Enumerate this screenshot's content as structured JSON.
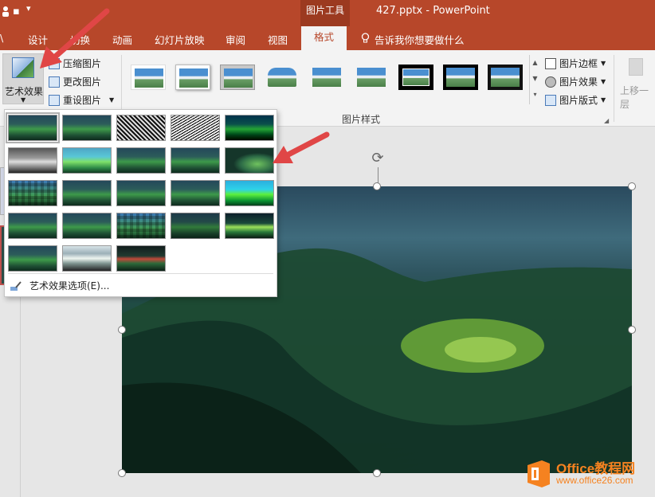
{
  "title_bar": {
    "context_tab": "图片工具",
    "document_title": "427.pptx - PowerPoint"
  },
  "tabs": [
    {
      "label": "设计"
    },
    {
      "label": "切换"
    },
    {
      "label": "动画"
    },
    {
      "label": "幻灯片放映"
    },
    {
      "label": "审阅"
    },
    {
      "label": "视图"
    },
    {
      "label": "格式"
    }
  ],
  "tell_me": "告诉我你想要做什么",
  "ribbon": {
    "artistic_effects": "艺术效果",
    "compress": "压缩图片",
    "change": "更改图片",
    "reset": "重设图片",
    "picture_styles_group": "图片样式",
    "border": "图片边框",
    "effects": "图片效果",
    "layout": "图片版式",
    "bring_forward": "上移一层"
  },
  "dropdown": {
    "option_label": "艺术效果选项(E)...",
    "effects": [
      {
        "name": "无"
      },
      {
        "name": "标记"
      },
      {
        "name": "铅笔灰度"
      },
      {
        "name": "铅笔素描"
      },
      {
        "name": "线条图"
      },
      {
        "name": "粉笔素描"
      },
      {
        "name": "画图笔划"
      },
      {
        "name": "画图刷"
      },
      {
        "name": "发光散射"
      },
      {
        "name": "虚化"
      },
      {
        "name": "浅色屏幕"
      },
      {
        "name": "水彩海绵"
      },
      {
        "name": "胶片颗粒"
      },
      {
        "name": "马赛克气泡"
      },
      {
        "name": "玻璃"
      },
      {
        "name": "混凝土"
      },
      {
        "name": "纹理化"
      },
      {
        "name": "十字图案蚀刻"
      },
      {
        "name": "蜡笔平滑"
      },
      {
        "name": "塑封"
      },
      {
        "name": "图样"
      },
      {
        "name": "影印"
      },
      {
        "name": "发光边缘"
      }
    ]
  },
  "watermark": {
    "title": "Office教程网",
    "url": "www.office26.com"
  },
  "colors": {
    "accent": "#b7472a",
    "arrow": "#e04646",
    "watermark": "#f58220"
  }
}
